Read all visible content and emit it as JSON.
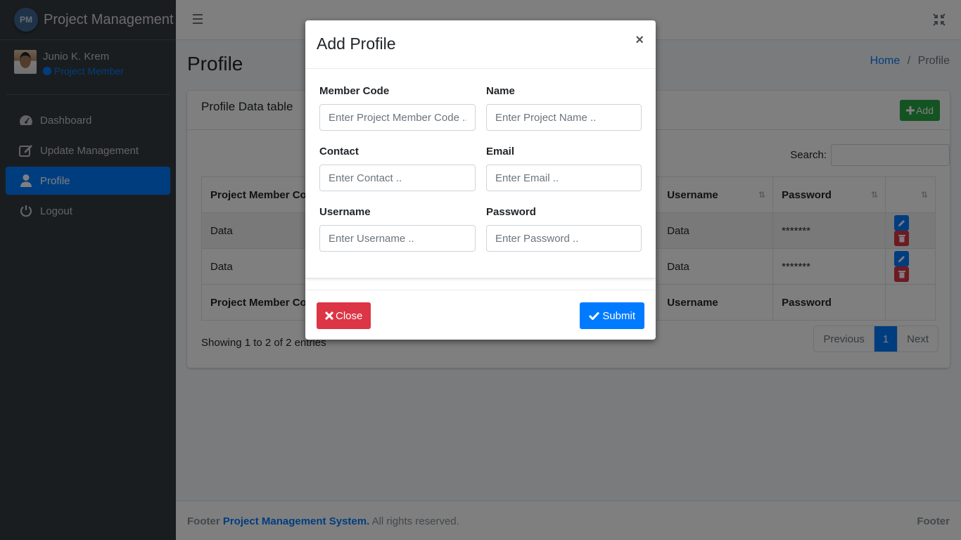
{
  "brand": {
    "logo_text": "PM",
    "name": "Project Management"
  },
  "user": {
    "name": "Junio K. Krem",
    "role": "Project Member"
  },
  "nav": [
    {
      "label": "Dashboard",
      "icon": "dashboard-icon"
    },
    {
      "label": "Update Management",
      "icon": "edit-icon"
    },
    {
      "label": "Profile",
      "icon": "user-icon",
      "active": true
    },
    {
      "label": "Logout",
      "icon": "power-icon"
    }
  ],
  "page": {
    "title": "Profile"
  },
  "breadcrumb": {
    "home": "Home",
    "separator": "/",
    "current": "Profile"
  },
  "card": {
    "title": "Profile Data table",
    "add_label": "Add"
  },
  "table": {
    "search_label": "Search:",
    "columns": [
      "Project Member Code",
      "Username",
      "Password",
      ""
    ],
    "rows": [
      {
        "code": "Data",
        "username": "Data",
        "password": "*******"
      },
      {
        "code": "Data",
        "username": "Data",
        "password": "*******"
      }
    ],
    "footer_columns": [
      "Project Member Code",
      "Username",
      "Password"
    ],
    "showing": "Showing 1 to 2 of 2 entries"
  },
  "pagination": {
    "previous": "Previous",
    "current": "1",
    "next": "Next"
  },
  "footer": {
    "prefix": "Footer",
    "link": "Project Management System.",
    "suffix": "All rights reserved.",
    "right": "Footer"
  },
  "modal": {
    "title": "Add Profile",
    "close_x": "×",
    "fields": {
      "member_code": {
        "label": "Member Code",
        "placeholder": "Enter Project Member Code .."
      },
      "name": {
        "label": "Name",
        "placeholder": "Enter Project Name .."
      },
      "contact": {
        "label": "Contact",
        "placeholder": "Enter Contact .."
      },
      "email": {
        "label": "Email",
        "placeholder": "Enter Email .."
      },
      "username": {
        "label": "Username",
        "placeholder": "Enter Username .."
      },
      "password": {
        "label": "Password",
        "placeholder": "Enter Password .."
      }
    },
    "close_label": "Close",
    "submit_label": "Submit"
  },
  "colors": {
    "primary": "#007bff",
    "success": "#28a745",
    "danger": "#dc3545",
    "sidebar": "#343a40"
  }
}
